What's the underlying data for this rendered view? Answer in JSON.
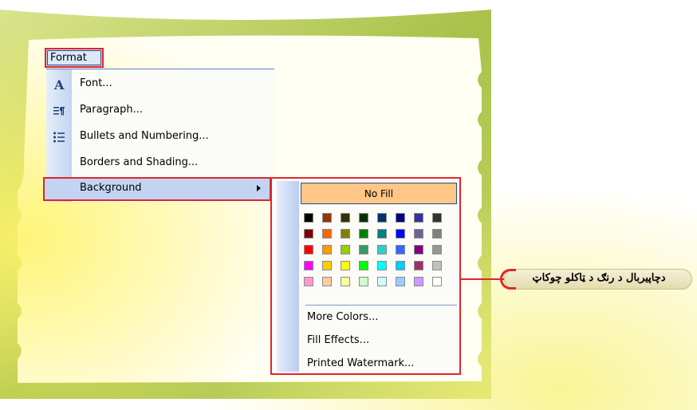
{
  "menubar": {
    "format_label": "Format",
    "format_mnemonic": "o"
  },
  "format_menu": {
    "items": [
      {
        "label": "Font...",
        "icon": "font-a-icon"
      },
      {
        "label": "Paragraph...",
        "icon": "paragraph-icon"
      },
      {
        "label": "Bullets and Numbering...",
        "icon": "bullets-icon"
      },
      {
        "label": "Borders and Shading...",
        "icon": ""
      },
      {
        "label": "Background",
        "icon": ""
      }
    ]
  },
  "background_submenu": {
    "no_fill_label": "No Fill",
    "palette": [
      [
        "#000000",
        "#993300",
        "#333300",
        "#003300",
        "#003366",
        "#000080",
        "#333399",
        "#333333"
      ],
      [
        "#800000",
        "#FF6600",
        "#808000",
        "#008000",
        "#008080",
        "#0000FF",
        "#666699",
        "#808080"
      ],
      [
        "#FF0000",
        "#FF9900",
        "#99CC00",
        "#339966",
        "#33CCCC",
        "#3366FF",
        "#800080",
        "#969696"
      ],
      [
        "#FF00FF",
        "#FFCC00",
        "#FFFF00",
        "#00FF00",
        "#00FFFF",
        "#00CCFF",
        "#993366",
        "#C0C0C0"
      ],
      [
        "#FF99CC",
        "#FFCC99",
        "#FFFF99",
        "#CCFFCC",
        "#CCFFFF",
        "#99CCFF",
        "#CC99FF",
        "#FFFFFF"
      ]
    ],
    "items": [
      {
        "label": "More Colors..."
      },
      {
        "label": "Fill Effects..."
      },
      {
        "label": "Printed Watermark..."
      }
    ]
  },
  "callout": {
    "text": "دچاپیربال د رنګ د ټاکلو چوکاټ"
  },
  "colors": {
    "highlight_border": "#E0262C",
    "menu_highlight": "#C3D4F2",
    "no_fill_bg": "#FFC685"
  }
}
